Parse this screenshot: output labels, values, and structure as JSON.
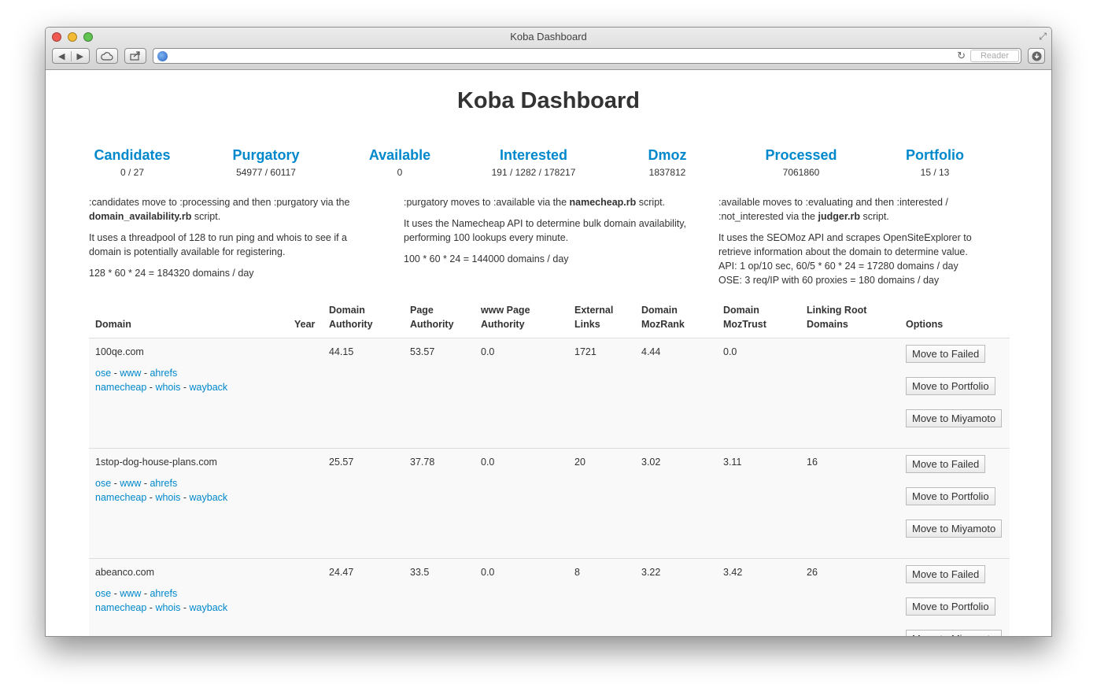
{
  "window": {
    "title": "Koba Dashboard",
    "reader_label": "Reader",
    "url": ""
  },
  "page": {
    "title": "Koba Dashboard"
  },
  "stats": [
    {
      "label": "Candidates",
      "value": "0 / 27"
    },
    {
      "label": "Purgatory",
      "value": "54977 / 60117"
    },
    {
      "label": "Available",
      "value": "0"
    },
    {
      "label": "Interested",
      "value": "191 / 1282 / 178217"
    },
    {
      "label": "Dmoz",
      "value": "1837812"
    },
    {
      "label": "Processed",
      "value": "7061860"
    },
    {
      "label": "Portfolio",
      "value": "15 / 13"
    }
  ],
  "descriptions": {
    "col1": {
      "p1_pre": ":candidates move to :processing and then :purgatory via the ",
      "p1_bold": "domain_availability.rb",
      "p1_post": " script.",
      "p2": "It uses a threadpool of 128 to run ping and whois to see if a domain is potentially available for registering.",
      "p3": "128 * 60 * 24 = 184320 domains / day"
    },
    "col2": {
      "p1_pre": ":purgatory moves to :available via the ",
      "p1_bold": "namecheap.rb",
      "p1_post": " script.",
      "p2": "It uses the Namecheap API to determine bulk domain availability, performing 100 lookups every minute.",
      "p3": "100 * 60 * 24 = 144000 domains / day"
    },
    "col3": {
      "p1_pre": ":available moves to :evaluating and then :interested / :not_interested via the ",
      "p1_bold": "judger.rb",
      "p1_post": " script.",
      "p2": "It uses the SEOMoz API and scrapes OpenSiteExplorer to retrieve information about the domain to determine value.",
      "p3": "API: 1 op/10 sec, 60/5 * 60 * 24 = 17280 domains / day",
      "p4": "OSE: 3 req/IP with 60 proxies = 180 domains / day"
    }
  },
  "table": {
    "headers": {
      "domain": "Domain",
      "year": "Year",
      "domain_authority_1": "Domain",
      "domain_authority_2": "Authority",
      "page_authority_1": "Page",
      "page_authority_2": "Authority",
      "www_page_authority_1": "www Page",
      "www_page_authority_2": "Authority",
      "external_links_1": "External",
      "external_links_2": "Links",
      "domain_mozrank_1": "Domain",
      "domain_mozrank_2": "MozRank",
      "domain_moztrust_1": "Domain",
      "domain_moztrust_2": "MozTrust",
      "linking_root_1": "Linking Root",
      "linking_root_2": "Domains",
      "options": "Options"
    },
    "link_labels": {
      "ose": "ose",
      "www": "www",
      "ahrefs": "ahrefs",
      "namecheap": "namecheap",
      "whois": "whois",
      "wayback": "wayback",
      "sep": " - "
    },
    "button_labels": {
      "failed": "Move to Failed",
      "portfolio": "Move to Portfolio",
      "miyamoto": "Move to Miyamoto"
    },
    "rows": [
      {
        "domain": "100qe.com",
        "year": "",
        "domain_authority": "44.15",
        "page_authority": "53.57",
        "www_page_authority": "0.0",
        "external_links": "1721",
        "domain_mozrank": "4.44",
        "domain_moztrust": "0.0",
        "linking_root_domains": ""
      },
      {
        "domain": "1stop-dog-house-plans.com",
        "year": "",
        "domain_authority": "25.57",
        "page_authority": "37.78",
        "www_page_authority": "0.0",
        "external_links": "20",
        "domain_mozrank": "3.02",
        "domain_moztrust": "3.11",
        "linking_root_domains": "16"
      },
      {
        "domain": "abeanco.com",
        "year": "",
        "domain_authority": "24.47",
        "page_authority": "33.5",
        "www_page_authority": "0.0",
        "external_links": "8",
        "domain_mozrank": "3.22",
        "domain_moztrust": "3.42",
        "linking_root_domains": "26"
      }
    ]
  }
}
